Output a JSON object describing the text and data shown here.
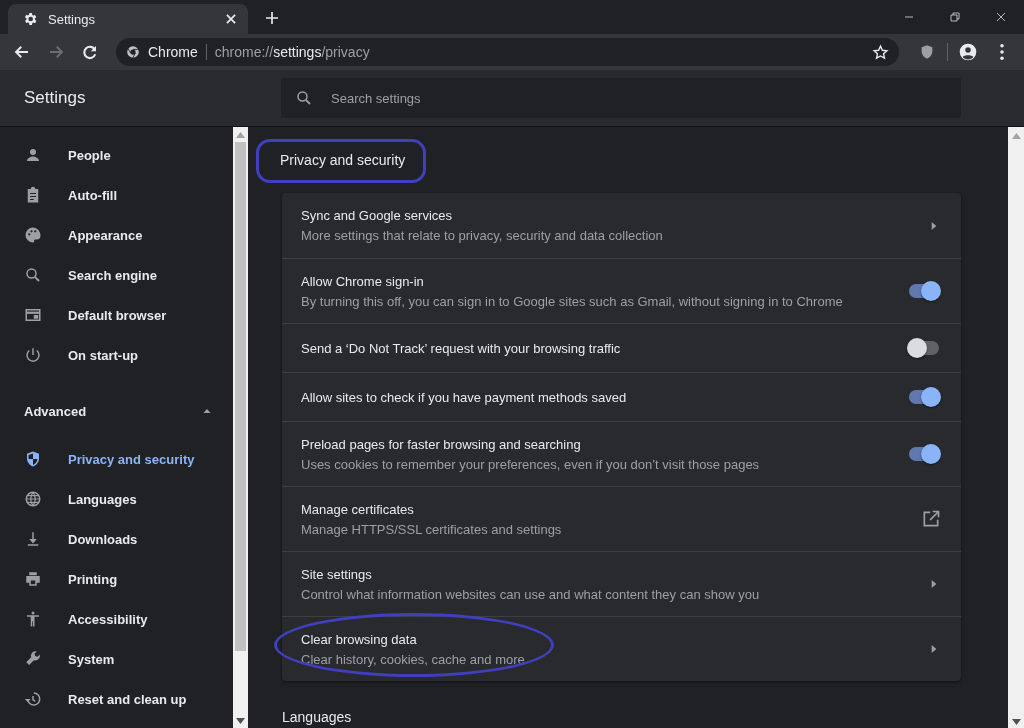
{
  "tab": {
    "title": "Settings",
    "selected": true
  },
  "address_bar": {
    "site": "Chrome",
    "url_prefix": "chrome://",
    "url_host": "settings",
    "url_path": "/privacy"
  },
  "header": {
    "title": "Settings",
    "search": {
      "placeholder": "Search settings"
    }
  },
  "sidebar": {
    "items": [
      {
        "label": "People",
        "selected": false
      },
      {
        "label": "Auto-fill",
        "selected": false
      },
      {
        "label": "Appearance",
        "selected": false
      },
      {
        "label": "Search engine",
        "selected": false
      },
      {
        "label": "Default browser",
        "selected": false
      },
      {
        "label": "On start-up",
        "selected": false
      }
    ],
    "advanced": {
      "label": "Advanced",
      "expanded": true,
      "items": [
        {
          "label": "Privacy and security",
          "selected": true
        },
        {
          "label": "Languages",
          "selected": false
        },
        {
          "label": "Downloads",
          "selected": false
        },
        {
          "label": "Printing",
          "selected": false
        },
        {
          "label": "Accessibility",
          "selected": false
        },
        {
          "label": "System",
          "selected": false
        },
        {
          "label": "Reset and clean up",
          "selected": false
        }
      ]
    }
  },
  "section": {
    "title": "Privacy and security",
    "highlighted": true,
    "rows": [
      {
        "kind": "link",
        "title": "Sync and Google services",
        "subtitle": "More settings that relate to privacy, security and data collection",
        "highlighted": false
      },
      {
        "kind": "toggle",
        "title": "Allow Chrome sign-in",
        "subtitle": "By turning this off, you can sign in to Google sites such as Gmail, without signing in to Chrome",
        "on": true,
        "highlighted": false
      },
      {
        "kind": "toggle",
        "title": "Send a ‘Do Not Track’ request with your browsing traffic",
        "on": false,
        "highlighted": false
      },
      {
        "kind": "toggle",
        "title": "Allow sites to check if you have payment methods saved",
        "on": true,
        "highlighted": false
      },
      {
        "kind": "toggle",
        "title": "Preload pages for faster browsing and searching",
        "subtitle": "Uses cookies to remember your preferences, even if you don’t visit those pages",
        "on": true,
        "highlighted": false
      },
      {
        "kind": "external",
        "title": "Manage certificates",
        "subtitle": "Manage HTTPS/SSL certificates and settings",
        "highlighted": false
      },
      {
        "kind": "link",
        "title": "Site settings",
        "subtitle": "Control what information websites can use and what content they can show you",
        "highlighted": false
      },
      {
        "kind": "link",
        "title": "Clear browsing data",
        "subtitle": "Clear history, cookies, cache and more",
        "highlighted": true
      }
    ]
  },
  "next_section": {
    "title": "Languages"
  }
}
